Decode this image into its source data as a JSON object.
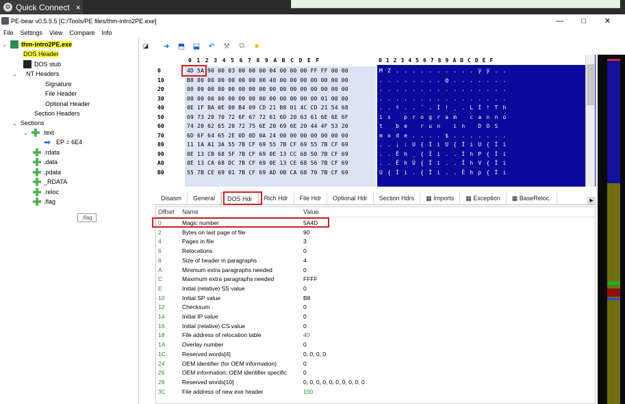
{
  "browser_tab": {
    "title": "Quick Connect",
    "close": "×"
  },
  "window": {
    "title": "PE-bear v0.5.5.5 [C:/Tools/PE files/thm-intro2PE.exe]",
    "minimize": "—",
    "maximize": "□",
    "close": "✕"
  },
  "menu": [
    "File",
    "Settings",
    "View",
    "Compare",
    "Info"
  ],
  "tree": {
    "root": "thm-intro2PE.exe",
    "items": {
      "dos_header": "DOS Header",
      "dos_stub": "DOS stub",
      "nt_headers": "NT Headers",
      "signature": "Signature",
      "file_header": "File Header",
      "optional_header": "Optional Header",
      "section_headers": "Section Headers",
      "sections": "Sections",
      "text": ".text",
      "ep": "EP = 6E4",
      "rdata": ".rdata",
      "data": ".data",
      "pdata": ".pdata",
      "RDATA": "_RDATA",
      "reloc": ".reloc",
      "flag": ".flag"
    },
    "tooltip": ".flag"
  },
  "hex": {
    "header": "0 1 2 3 4 5 6 7 8 9 A B C D E F",
    "ascii_header": "0 1 2 3 4 5 6 7 8 9 A B C D E F",
    "addresses": [
      "0",
      "10",
      "20",
      "30",
      "40",
      "50",
      "60",
      "70",
      "80",
      "90",
      "A0",
      "B0"
    ],
    "rows": [
      "4D 5A 90 00 03 00 00 00 04 00 00 00 FF FF 00 00",
      "B8 00 00 00 00 00 00 00 40 00 00 00 00 00 00 00",
      "00 00 00 00 00 00 00 00 00 00 00 00 00 00 00 00",
      "00 00 00 00 00 00 00 00 00 00 00 00 00 01 00 00",
      "0E 1F BA 0E 00 B4 09 CD 21 B8 01 4C CD 21 54 68",
      "69 73 20 70 72 6F 67 72 61 6D 20 63 61 6E 6E 6F",
      "74 20 62 65 20 72 75 6E 20 69 6E 20 44 4F 53 20",
      "6D 6F 64 65 2E 0D 0D 0A 24 00 00 00 00 00 00 00",
      "11 1A A1 3A 55 7B CF 69 55 7B CF 69 55 7B CF 69",
      "0E 13 CB 68 5F 7B CF 69 0E 13 CC 68 50 7B CF 69",
      "0E 13 CA 68 DC 7B CF 69 0E 13 CE 68 56 7B CF 69",
      "55 7B CE 69 01 7B CF 69 AD 0B CA 68 70 7B CF 69"
    ],
    "ascii_rows": [
      "M Z . . . . . . . . . . ÿ ÿ . .",
      ". . . . . . . . @ . . . . . . .",
      ". . . . . . . . . . . . . . . .",
      ". . . . . . . . . . . . . . . .",
      ". . º . . ´ . Í ! ¸ . L Í ! T h",
      "i s   p r o g r a m   c a n n o",
      "t   b e   r u n   i n   D O S  ",
      "m o d e . . . . $ . . . . . . .",
      ". . ¡ : U { Ï i U { Ï i U { Ï i",
      ". . Ë h _ { Ï i . . Ì h P { Ï i",
      ". . Ê h Ü { Ï i . . Î h V { Ï i",
      "U { Î i . { Ï i . . Ê h p { Ï i"
    ]
  },
  "tabs": [
    "Disasm",
    "General",
    "DOS Hdr",
    "Rich Hdr",
    "File Hdr",
    "Optional Hdr",
    "Section Hdrs",
    "Imports",
    "Exception",
    "BaseReloc."
  ],
  "table": {
    "columns": [
      "Offset",
      "Name",
      "Value"
    ],
    "rows": [
      {
        "offset": "0",
        "name": "Magic number",
        "value": "5A4D"
      },
      {
        "offset": "2",
        "name": "Bytes on last page of file",
        "value": "90"
      },
      {
        "offset": "4",
        "name": "Pages in file",
        "value": "3"
      },
      {
        "offset": "6",
        "name": "Relocations",
        "value": "0"
      },
      {
        "offset": "8",
        "name": "Size of header in paragraphs",
        "value": "4"
      },
      {
        "offset": "A",
        "name": "Minimum extra paragraphs needed",
        "value": "0"
      },
      {
        "offset": "C",
        "name": "Maximum extra paragraphs needed",
        "value": "FFFF"
      },
      {
        "offset": "E",
        "name": "Initial (relative) SS value",
        "value": "0"
      },
      {
        "offset": "10",
        "name": "Initial SP value",
        "value": "B8"
      },
      {
        "offset": "12",
        "name": "Checksum",
        "value": "0"
      },
      {
        "offset": "14",
        "name": "Initial IP value",
        "value": "0"
      },
      {
        "offset": "16",
        "name": "Initial (relative) CS value",
        "value": "0"
      },
      {
        "offset": "18",
        "name": "File address of relocation table",
        "value": "40"
      },
      {
        "offset": "1A",
        "name": "Overlay number",
        "value": "0"
      },
      {
        "offset": "1C",
        "name": "Reserved words[4]",
        "value": "0, 0, 0, 0"
      },
      {
        "offset": "24",
        "name": "OEM identifier (for OEM information)",
        "value": "0"
      },
      {
        "offset": "26",
        "name": "OEM information; OEM identifier specific",
        "value": "0"
      },
      {
        "offset": "28",
        "name": "Reserved words[10]",
        "value": "0, 0, 0, 0, 0, 0, 0, 0, 0, 0"
      },
      {
        "offset": "3C",
        "name": "File address of new exe header",
        "value": "100"
      }
    ]
  },
  "colors": {
    "highlight_yellow": "#ffff3a",
    "annotation_red": "#d21d1d",
    "ascii_bg": "#0a0a9c",
    "offset_green": "#2d8a2d"
  },
  "icons": [
    "quick-connect-icon",
    "pin-icon",
    "toolbar-forward-icon",
    "toolbar-save-icon",
    "toolbar-add-icon",
    "undo-icon",
    "tool-icon",
    "copy-icon",
    "star-icon"
  ]
}
